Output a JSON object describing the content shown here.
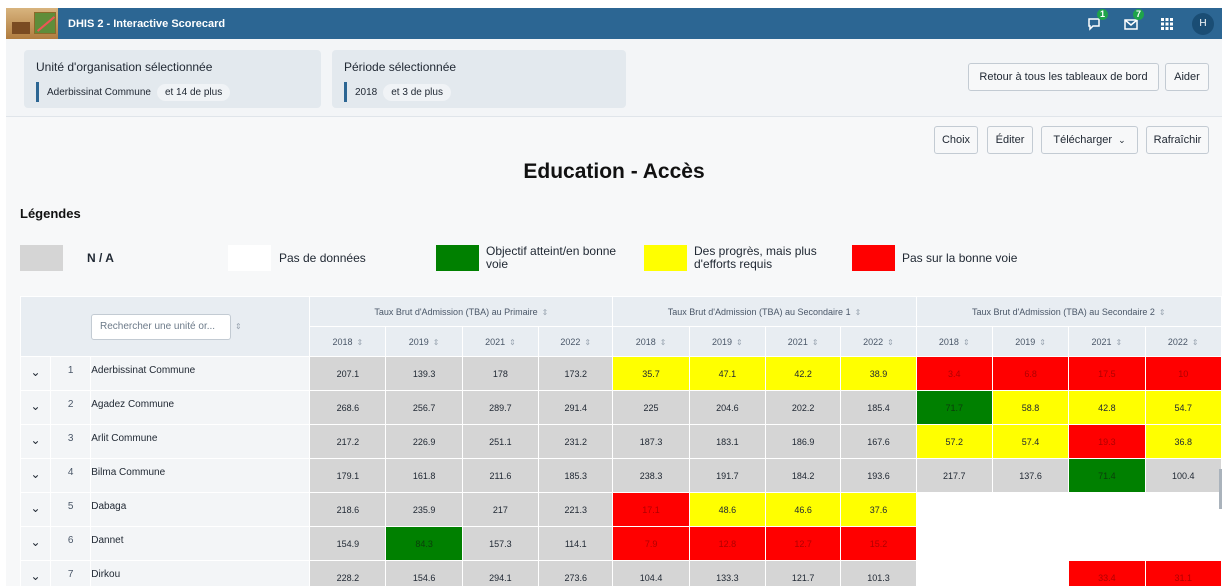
{
  "header": {
    "app_title": "DHIS 2 - Interactive Scorecard",
    "interpretations_count": "1",
    "messages_count": "7",
    "avatar_initial": "H"
  },
  "selection": {
    "org_unit_label": "Unité d'organisation sélectionnée",
    "org_unit_value": "Aderbissinat Commune",
    "org_unit_more": "et 14 de plus",
    "period_label": "Période sélectionnée",
    "period_value": "2018",
    "period_more": "et 3 de plus",
    "back_button": "Retour à tous les tableaux de bord",
    "help_button": "Aider"
  },
  "toolbar": {
    "choose": "Choix",
    "edit": "Éditer",
    "download": "Télécharger",
    "refresh": "Rafraîchir"
  },
  "page_title": "Education - Accès",
  "legends": {
    "title": "Légendes",
    "items": [
      {
        "label": "N / A",
        "color": "#d5d5d5"
      },
      {
        "label": "Pas de données",
        "color": "#ffffff"
      },
      {
        "label": "Objectif atteint/en bonne voie",
        "color": "#008000"
      },
      {
        "label": "Des progrès, mais plus d'efforts requis",
        "color": "#ffff00"
      },
      {
        "label": "Pas sur la bonne voie",
        "color": "#ff0000"
      }
    ]
  },
  "table": {
    "search_placeholder": "Rechercher une unité or...",
    "groups": [
      "Taux Brut d'Admission (TBA) au Primaire",
      "Taux Brut d'Admission (TBA) au Secondaire 1",
      "Taux Brut d'Admission (TBA) au Secondaire 2"
    ],
    "periods": [
      "2018",
      "2019",
      "2021",
      "2022"
    ],
    "rows": [
      {
        "index": "1",
        "name": "Aderbissinat Commune",
        "values": [
          "207.1",
          "139.3",
          "178",
          "173.2",
          "35.7",
          "47.1",
          "42.2",
          "38.9",
          "3.4",
          "6.8",
          "17.5",
          "10"
        ],
        "colors": [
          "g",
          "g",
          "g",
          "g",
          "y",
          "y",
          "y",
          "y",
          "r",
          "r",
          "r",
          "r"
        ]
      },
      {
        "index": "2",
        "name": "Agadez Commune",
        "values": [
          "268.6",
          "256.7",
          "289.7",
          "291.4",
          "225",
          "204.6",
          "202.2",
          "185.4",
          "71.7",
          "58.8",
          "42.8",
          "54.7"
        ],
        "colors": [
          "g",
          "g",
          "g",
          "g",
          "g",
          "g",
          "g",
          "g",
          "G",
          "y",
          "y",
          "y"
        ]
      },
      {
        "index": "3",
        "name": "Arlit Commune",
        "values": [
          "217.2",
          "226.9",
          "251.1",
          "231.2",
          "187.3",
          "183.1",
          "186.9",
          "167.6",
          "57.2",
          "57.4",
          "19.3",
          "36.8"
        ],
        "colors": [
          "g",
          "g",
          "g",
          "g",
          "g",
          "g",
          "g",
          "g",
          "y",
          "y",
          "r",
          "y"
        ]
      },
      {
        "index": "4",
        "name": "Bilma Commune",
        "values": [
          "179.1",
          "161.8",
          "211.6",
          "185.3",
          "238.3",
          "191.7",
          "184.2",
          "193.6",
          "217.7",
          "137.6",
          "71.4",
          "100.4"
        ],
        "colors": [
          "g",
          "g",
          "g",
          "g",
          "g",
          "g",
          "g",
          "g",
          "g",
          "g",
          "G",
          "g"
        ]
      },
      {
        "index": "5",
        "name": "Dabaga",
        "values": [
          "218.6",
          "235.9",
          "217",
          "221.3",
          "17.1",
          "48.6",
          "46.6",
          "37.6",
          "",
          "",
          "",
          ""
        ],
        "colors": [
          "g",
          "g",
          "g",
          "g",
          "r",
          "y",
          "y",
          "y",
          "w",
          "w",
          "w",
          "w"
        ]
      },
      {
        "index": "6",
        "name": "Dannet",
        "values": [
          "154.9",
          "84.3",
          "157.3",
          "114.1",
          "7.9",
          "12.8",
          "12.7",
          "15.2",
          "",
          "",
          "",
          ""
        ],
        "colors": [
          "g",
          "G",
          "g",
          "g",
          "r",
          "r",
          "r",
          "r",
          "w",
          "w",
          "w",
          "w"
        ]
      },
      {
        "index": "7",
        "name": "Dirkou",
        "values": [
          "228.2",
          "154.6",
          "294.1",
          "273.6",
          "104.4",
          "133.3",
          "121.7",
          "101.3",
          "",
          "",
          "33.4",
          "31.1"
        ],
        "colors": [
          "g",
          "g",
          "g",
          "g",
          "g",
          "g",
          "g",
          "g",
          "w",
          "w",
          "r",
          "r"
        ]
      }
    ]
  }
}
